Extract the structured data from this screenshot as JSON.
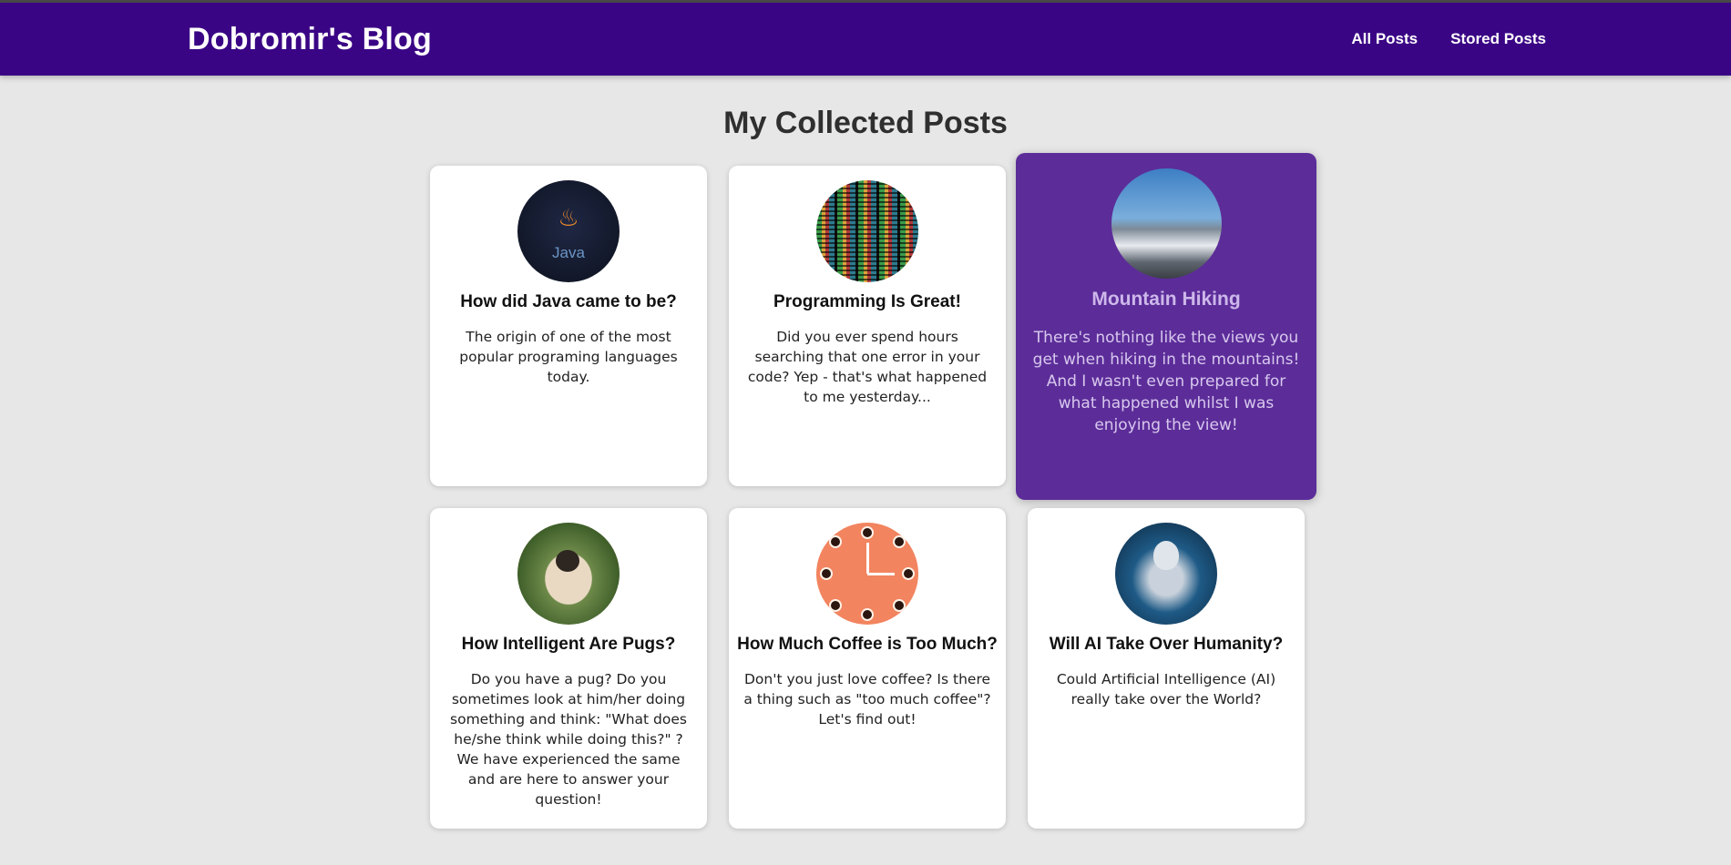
{
  "header": {
    "logo": "Dobromir's Blog",
    "nav": [
      {
        "label": "All Posts"
      },
      {
        "label": "Stored Posts"
      }
    ]
  },
  "main": {
    "title": "My Collected Posts",
    "posts": [
      {
        "title": "How did Java came to be?",
        "excerpt": "The origin of one of the most popular programing languages today.",
        "icon": "java-logo-image"
      },
      {
        "title": "Programming Is Great!",
        "excerpt": "Did you ever spend hours searching that one error in your code? Yep - that's what happened to me yesterday...",
        "icon": "code-screen-image"
      },
      {
        "title": "Mountain Hiking",
        "excerpt": "There's nothing like the views you get when hiking in the mountains! And I wasn't even prepared for what happened whilst I was enjoying the view!",
        "icon": "mountains-image",
        "state": "hovered"
      },
      {
        "title": "How Intelligent Are Pugs?",
        "excerpt": "Do you have a pug? Do you sometimes look at him/her doing something and think: \"What does he/she think while doing this?\" ? We have experienced the same and are here to answer your question!",
        "icon": "pug-image"
      },
      {
        "title": "How Much Coffee is Too Much?",
        "excerpt": "Don't you just love coffee? Is there a thing such as \"too much coffee\"? Let's find out!",
        "icon": "coffee-clock-image"
      },
      {
        "title": "Will AI Take Over Humanity?",
        "excerpt": "Could Artificial Intelligence (AI) really take over the World?",
        "icon": "robot-image"
      }
    ]
  },
  "colors": {
    "header_bg": "#3a0585",
    "page_bg": "#e7e7e7",
    "active_card_bg": "#5c2d99",
    "card_bg": "#ffffff"
  }
}
